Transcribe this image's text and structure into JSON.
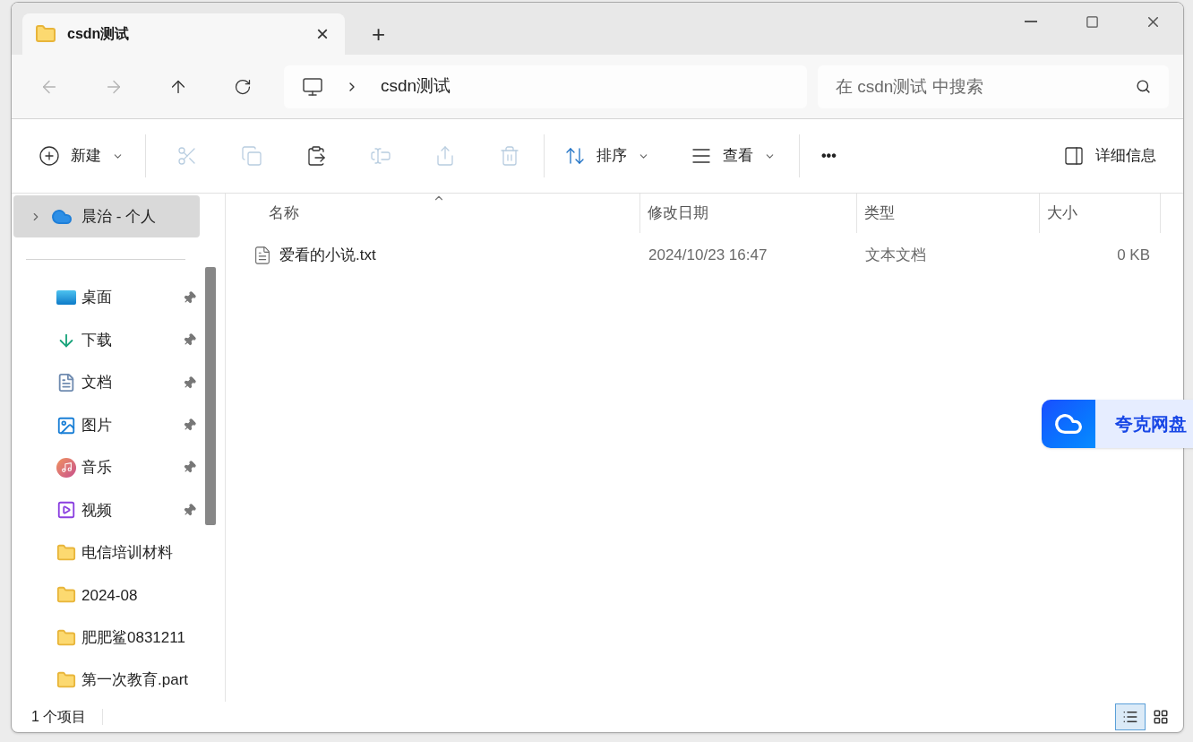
{
  "tab": {
    "title": "csdn测试",
    "close": "×",
    "new_tab": "+"
  },
  "nav": {
    "back_disabled": true,
    "forward_disabled": true,
    "breadcrumb": [
      "csdn测试"
    ],
    "search": {
      "placeholder": "在 csdn测试 中搜索"
    }
  },
  "toolbar": {
    "new": "新建",
    "actions": [
      {
        "kind": "cut",
        "disabled": true
      },
      {
        "kind": "copy",
        "disabled": true
      },
      {
        "kind": "paste",
        "disabled": false
      },
      {
        "kind": "rename",
        "disabled": true
      },
      {
        "kind": "share",
        "disabled": true
      },
      {
        "kind": "delete",
        "disabled": true
      }
    ],
    "sort": "排序",
    "view": "查看",
    "more": "•••",
    "details": "详细信息"
  },
  "sidebar": {
    "account": {
      "label": "晨治 - 个人",
      "selected": true,
      "expanded": false
    },
    "items": [
      {
        "label": "桌面",
        "kind": "desktop",
        "pinned": true
      },
      {
        "label": "下载",
        "kind": "download",
        "pinned": true
      },
      {
        "label": "文档",
        "kind": "document",
        "pinned": true
      },
      {
        "label": "图片",
        "kind": "picture",
        "pinned": true
      },
      {
        "label": "音乐",
        "kind": "music",
        "pinned": true
      },
      {
        "label": "视频",
        "kind": "video",
        "pinned": true
      },
      {
        "label": "电信培训材料",
        "kind": "folder",
        "pinned": false
      },
      {
        "label": "2024-08",
        "kind": "folder",
        "pinned": false
      },
      {
        "label": "肥肥鲨0831211",
        "kind": "folder",
        "pinned": false
      },
      {
        "label": "第一次教育.part",
        "kind": "folder",
        "pinned": false
      }
    ]
  },
  "table": {
    "columns": [
      {
        "label": "名称",
        "sorted": true
      },
      {
        "label": "修改日期",
        "sorted": false
      },
      {
        "label": "类型",
        "sorted": false
      },
      {
        "label": "大小",
        "sorted": false
      }
    ],
    "rows": [
      {
        "name": "爱看的小说.txt",
        "date": "2024/10/23 16:47",
        "type": "文本文档",
        "size": "0 KB"
      }
    ]
  },
  "status_bar": {
    "count": "1 个项目",
    "views": [
      {
        "kind": "details",
        "selected": true
      },
      {
        "kind": "tiles",
        "selected": false
      }
    ]
  },
  "overlay": {
    "label": "夸克网盘"
  }
}
